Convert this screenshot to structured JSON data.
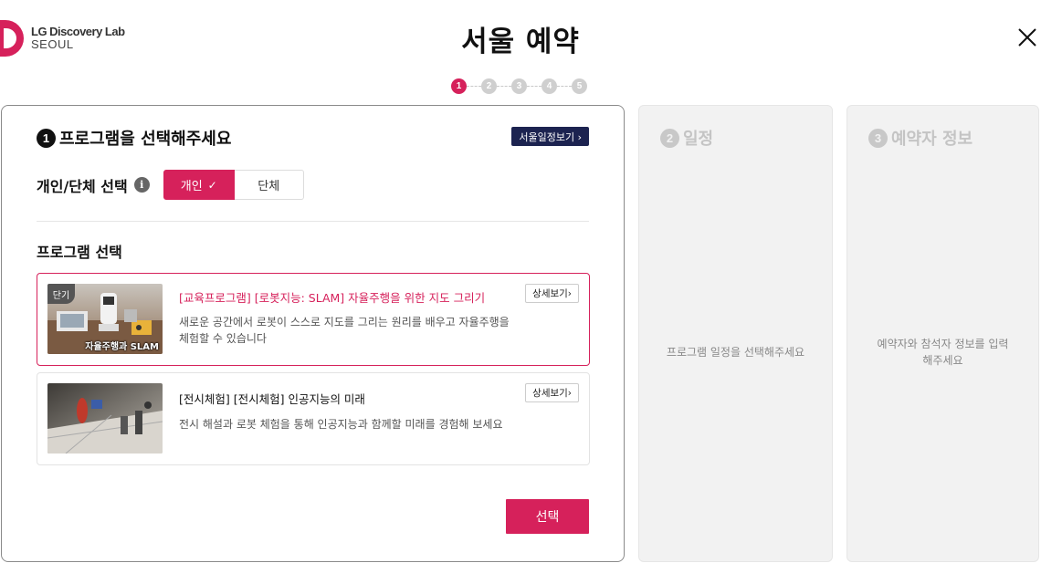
{
  "header": {
    "logo_line1": "LG Discovery Lab",
    "logo_line2": "SEOUL",
    "title": "서울 예약",
    "brand_color": "#d6215b"
  },
  "stepper": {
    "steps": [
      "1",
      "2",
      "3",
      "4",
      "5"
    ],
    "active": 1
  },
  "section1": {
    "number": "1",
    "title": "프로그램을 선택해주세요",
    "schedule_button": "서울일정보기 ›",
    "type_label": "개인/단체 선택",
    "type_options": [
      {
        "label": "개인",
        "selected": true
      },
      {
        "label": "단체",
        "selected": false
      }
    ],
    "program_heading": "프로그램 선택",
    "programs": [
      {
        "badge": "단기",
        "thumb_caption": "자율주행과 SLAM",
        "title": "[교육프로그램] [로봇지능: SLAM] 자율주행을 위한 지도 그리기",
        "description": "새로운 공간에서 로봇이 스스로 지도를 그리는 원리를 배우고 자율주행을 체험할 수 있습니다",
        "detail_button": "상세보기›",
        "selected": true
      },
      {
        "title": "[전시체험] [전시체험] 인공지능의 미래",
        "description": "전시 해설과 로봇 체험을 통해 인공지능과 함께할 미래를 경험해 보세요",
        "detail_button": "상세보기›",
        "selected": false
      }
    ],
    "select_button": "선택"
  },
  "section2": {
    "number": "2",
    "title": "일정",
    "message": "프로그램 일정을 선택해주세요"
  },
  "section3": {
    "number": "3",
    "title": "예약자 정보",
    "message": "예약자와 참석자 정보를 입력해주세요"
  },
  "icons": {
    "close": "close-icon",
    "info": "info-icon",
    "check": "check-icon"
  }
}
